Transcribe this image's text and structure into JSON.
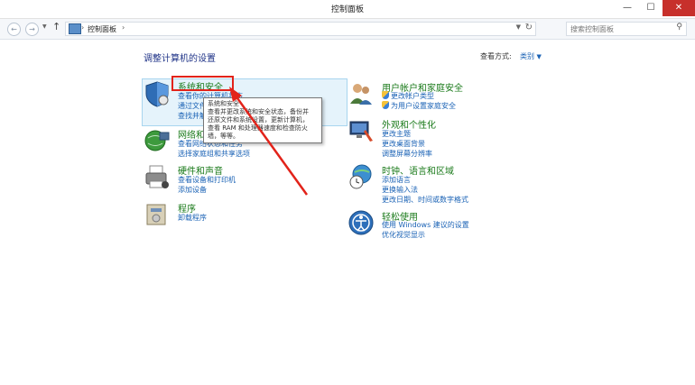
{
  "window": {
    "title": "控制面板",
    "minimize": "—",
    "maximize": "☐",
    "close": "✕"
  },
  "nav": {
    "back": "←",
    "forward": "→",
    "up": "↑",
    "breadcrumb": "控制面板",
    "sep": "›",
    "dropdown": "▼",
    "refresh": "↻"
  },
  "search": {
    "placeholder": "搜索控制面板",
    "icon": "search-icon"
  },
  "main": {
    "heading": "调整计算机的设置",
    "view_by_label": "查看方式:",
    "view_by_value": "类别"
  },
  "categories": [
    {
      "title": "系统和安全",
      "icon": "shield-icon",
      "links": [
        "查看你的计算机状态",
        "通过文件历史记录保存你的文件备份副本",
        "查找并解决问题"
      ]
    },
    {
      "title": "网络和 Internet",
      "icon": "network-globe-icon",
      "links": [
        "查看网络状态和任务",
        "选择家庭组和共享选项"
      ]
    },
    {
      "title": "硬件和声音",
      "icon": "printer-icon",
      "links": [
        "查看设备和打印机",
        "添加设备"
      ]
    },
    {
      "title": "程序",
      "icon": "programs-icon",
      "links": [
        "卸载程序"
      ]
    },
    {
      "title": "用户帐户和家庭安全",
      "icon": "users-icon",
      "links": [
        "更改帐户类型",
        "为用户设置家庭安全"
      ]
    },
    {
      "title": "外观和个性化",
      "icon": "monitor-brush-icon",
      "links": [
        "更改主题",
        "更改桌面背景",
        "调整屏幕分辨率"
      ]
    },
    {
      "title": "时钟、语言和区域",
      "icon": "clock-globe-icon",
      "links": [
        "添加语言",
        "更换输入法",
        "更改日期、时间或数字格式"
      ]
    },
    {
      "title": "轻松使用",
      "icon": "accessibility-icon",
      "links": [
        "使用 Windows 建议的设置",
        "优化视觉显示"
      ]
    }
  ],
  "tooltip": {
    "lines": [
      "系统和安全",
      "查看并更改系统和安全状态，备份并",
      "还原文件和系统设置，更新计算机，",
      "查看 RAM 和处理器速度和检查防火",
      "墙，等等。"
    ]
  },
  "colors": {
    "accent_link": "#1a62b5",
    "category_title": "#1a7a1a",
    "heading": "#1e3287",
    "red_annotation": "#e2231a",
    "hover_bg": "#e5f3fb"
  }
}
